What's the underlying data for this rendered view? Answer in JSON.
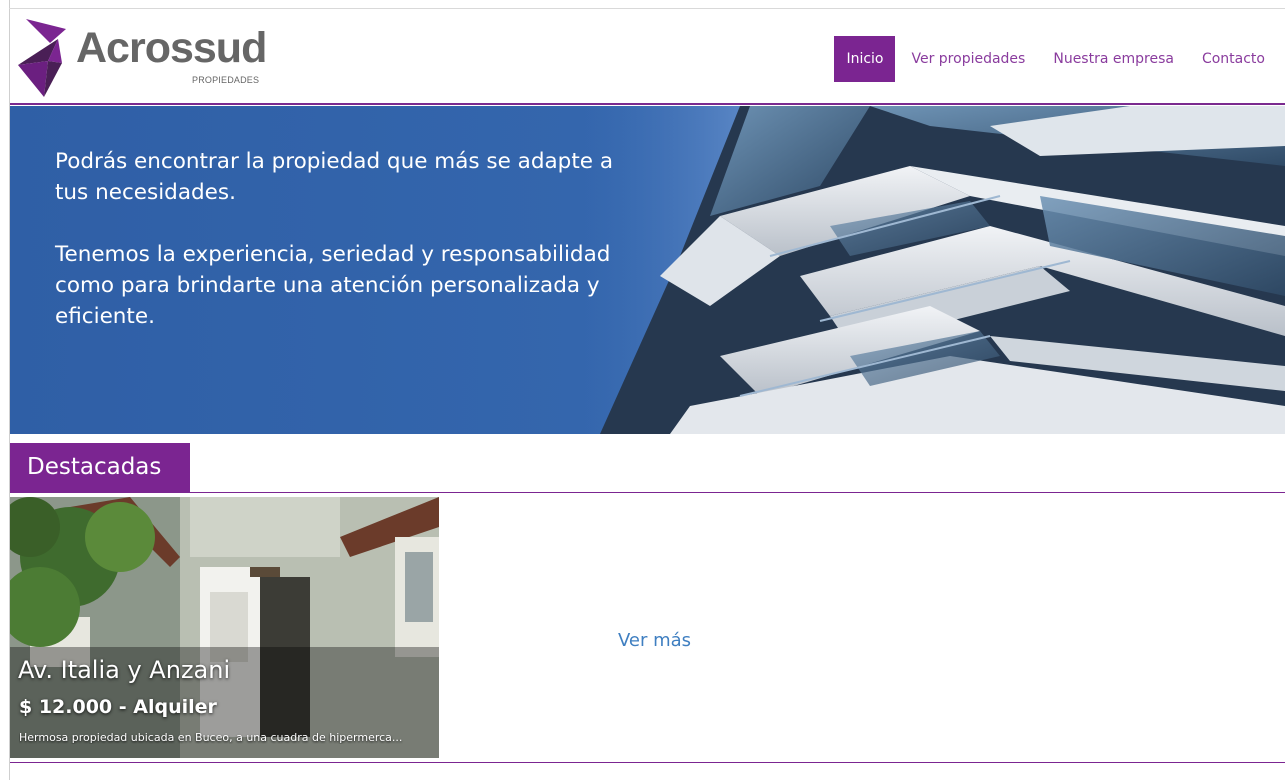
{
  "brand": {
    "name": "Acrossud",
    "tagline": "PROPIEDADES"
  },
  "nav": {
    "items": [
      {
        "label": "Inicio",
        "active": true
      },
      {
        "label": "Ver propiedades",
        "active": false
      },
      {
        "label": "Nuestra empresa",
        "active": false
      },
      {
        "label": "Contacto",
        "active": false
      }
    ]
  },
  "hero": {
    "line1": "Podrás encontrar la propiedad que más se adapte a tus necesidades.",
    "line2": "Tenemos la experiencia, seriedad y responsabilidad como para brindarte una atención personalizada y eficiente."
  },
  "featured": {
    "heading": "Destacadas",
    "items": [
      {
        "title": "Av. Italia y Anzani",
        "price": "$ 12.000 - Alquiler",
        "description": "Hermosa propiedad ubicada en Buceo, a una cuadra de hipermerca..."
      }
    ],
    "more_label": "Ver más"
  },
  "colors": {
    "accent": "#7b2591",
    "link": "#3f7fc1",
    "hero_blue": "#3466ad"
  }
}
